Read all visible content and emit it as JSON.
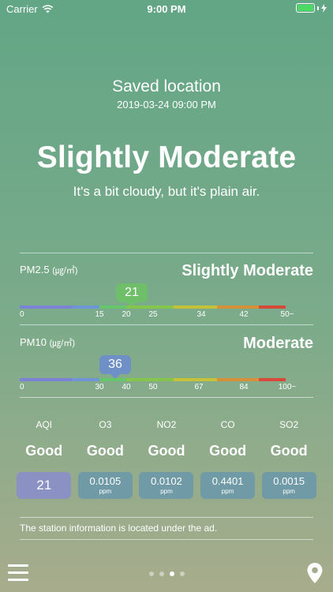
{
  "status_bar": {
    "carrier": "Carrier",
    "time": "9:00 PM"
  },
  "location": {
    "title": "Saved location",
    "datetime": "2019-03-24 09:00 PM"
  },
  "summary": {
    "status": "Slightly Moderate",
    "description": "It's a bit cloudy, but it's plain air."
  },
  "pm25": {
    "label": "PM2.5",
    "unit": "(㎍/㎥)",
    "status": "Slightly Moderate",
    "value": "21",
    "bubble_color": "#6fbf6a",
    "ticks": [
      "0",
      "15",
      "20",
      "25",
      "34",
      "42",
      "50~"
    ]
  },
  "pm10": {
    "label": "PM10",
    "unit": "(㎍/㎥)",
    "status": "Moderate",
    "value": "36",
    "bubble_color": "#6f8fc7",
    "ticks": [
      "0",
      "30",
      "40",
      "50",
      "67",
      "84",
      "100~"
    ]
  },
  "scale_colors": [
    "#7b83d6",
    "#6f95d6",
    "#66c66a",
    "#86c54b",
    "#c5c23a",
    "#d7903a",
    "#d74a3a"
  ],
  "pollutants": [
    {
      "name": "AQI",
      "grade": "Good",
      "value": "21",
      "unit": ""
    },
    {
      "name": "O3",
      "grade": "Good",
      "value": "0.0105",
      "unit": "ppm"
    },
    {
      "name": "NO2",
      "grade": "Good",
      "value": "0.0102",
      "unit": "ppm"
    },
    {
      "name": "CO",
      "grade": "Good",
      "value": "0.4401",
      "unit": "ppm"
    },
    {
      "name": "SO2",
      "grade": "Good",
      "value": "0.0015",
      "unit": "ppm"
    }
  ],
  "station_note": "The station information is located under the ad.",
  "pager": {
    "pages": 4,
    "active": 3
  },
  "icons": {
    "menu": "hamburger-menu-icon",
    "location": "location-pin-icon",
    "wifi": "wifi-icon",
    "battery": "battery-icon"
  }
}
